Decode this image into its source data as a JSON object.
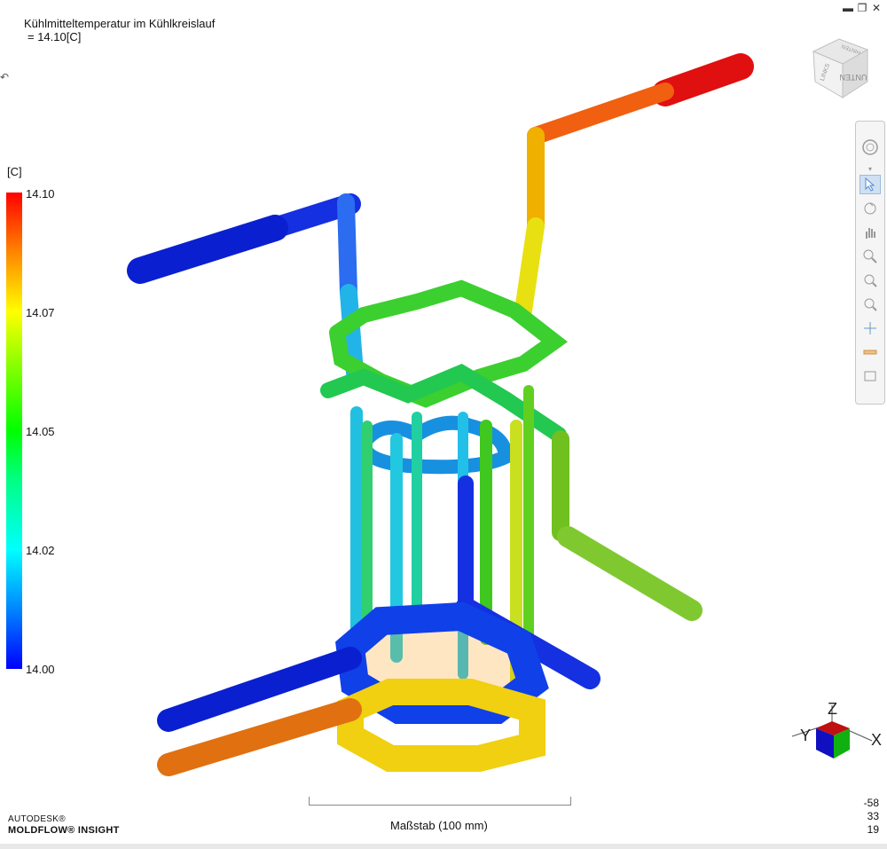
{
  "header": {
    "title_line1": "Kühlmitteltemperatur im Kühlkreislauf",
    "title_line2": "= 14.10[C]"
  },
  "window_controls": [
    "minimize-icon",
    "restore-icon",
    "close-icon"
  ],
  "viewcube": {
    "face_top": "UNTEN",
    "face_left": "LINKS",
    "face_back": "HINTEN"
  },
  "toolbar": {
    "tools": [
      "home-icon",
      "select-icon",
      "rotate-icon",
      "pan-icon",
      "zoom-icon",
      "zoom-window-icon",
      "zoom-fit-icon",
      "center-icon",
      "measure-icon",
      "display-icon"
    ]
  },
  "legend": {
    "unit": "[C]",
    "ticks": [
      "14.10",
      "14.07",
      "14.05",
      "14.02",
      "14.00"
    ],
    "colors": [
      "#ff0000",
      "#ffff00",
      "#00ff00",
      "#00ffff",
      "#0000ff"
    ]
  },
  "scale": {
    "label": "Maßstab (100 mm)"
  },
  "brand": {
    "line1": "AUTODESK®",
    "line2": "MOLDFLOW® INSIGHT"
  },
  "coords": {
    "x": "-58",
    "y": "33",
    "z": "19"
  },
  "triad": {
    "x": "X",
    "y": "Y",
    "z": "Z"
  }
}
